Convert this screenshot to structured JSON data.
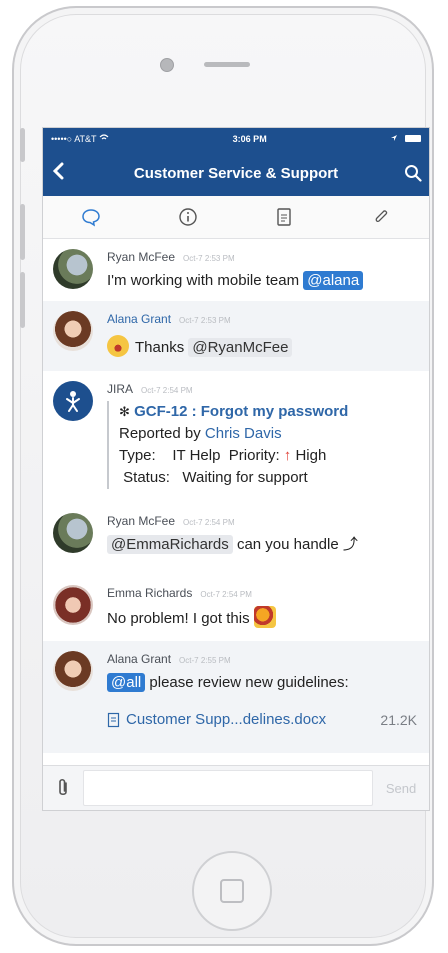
{
  "status_bar": {
    "carrier": "•••••○ AT&T",
    "wifi_icon": "wifi-icon",
    "time": "3:06 PM",
    "battery_icon": "battery-icon"
  },
  "nav": {
    "back_icon": "chevron-left-icon",
    "title": "Customer Service & Support",
    "search_icon": "search-icon"
  },
  "tabs": [
    {
      "name": "chat",
      "icon": "chat-bubble-icon",
      "active": true
    },
    {
      "name": "info",
      "icon": "info-icon",
      "active": false
    },
    {
      "name": "files",
      "icon": "document-icon",
      "active": false
    },
    {
      "name": "links",
      "icon": "paperclip-icon",
      "active": false
    }
  ],
  "messages": [
    {
      "sender": "Ryan McFee",
      "time": "Oct-7 2:53 PM",
      "text": "I'm working with mobile team",
      "mention": "@alana"
    },
    {
      "sender": "Alana Grant",
      "time": "Oct-7 2:53 PM",
      "text": "Thanks",
      "mention": "@RyanMcFee"
    },
    {
      "sender": "JIRA",
      "time": "Oct-7 2:54 PM",
      "issue": "GCF-12 : Forgot my password",
      "reported_by_label": "Reported by",
      "reported_by": "Chris Davis",
      "type_label": "Type:",
      "type_value": "IT Help",
      "priority_label": "Priority:",
      "priority_value": "High",
      "status_label": "Status:",
      "status_value": "Waiting for support"
    },
    {
      "sender": "Ryan McFee",
      "time": "Oct-7 2:54 PM",
      "mention": "@EmmaRichards",
      "text": "can you handle"
    },
    {
      "sender": "Emma Richards",
      "time": "Oct-7 2:54 PM",
      "text": "No problem! I got this"
    },
    {
      "sender": "Alana Grant",
      "time": "Oct-7 2:55 PM",
      "mention": "@all",
      "text": "please review new guidelines:",
      "file_name": "Customer Supp...delines.docx",
      "file_size": "21.2K"
    }
  ],
  "composer": {
    "placeholder": "",
    "send_label": "Send"
  },
  "colors": {
    "nav_bar": "#1d4f8e",
    "mention_blue": "#2f7bd1",
    "link_blue": "#2f67a8",
    "priority_red": "#e0433a"
  }
}
